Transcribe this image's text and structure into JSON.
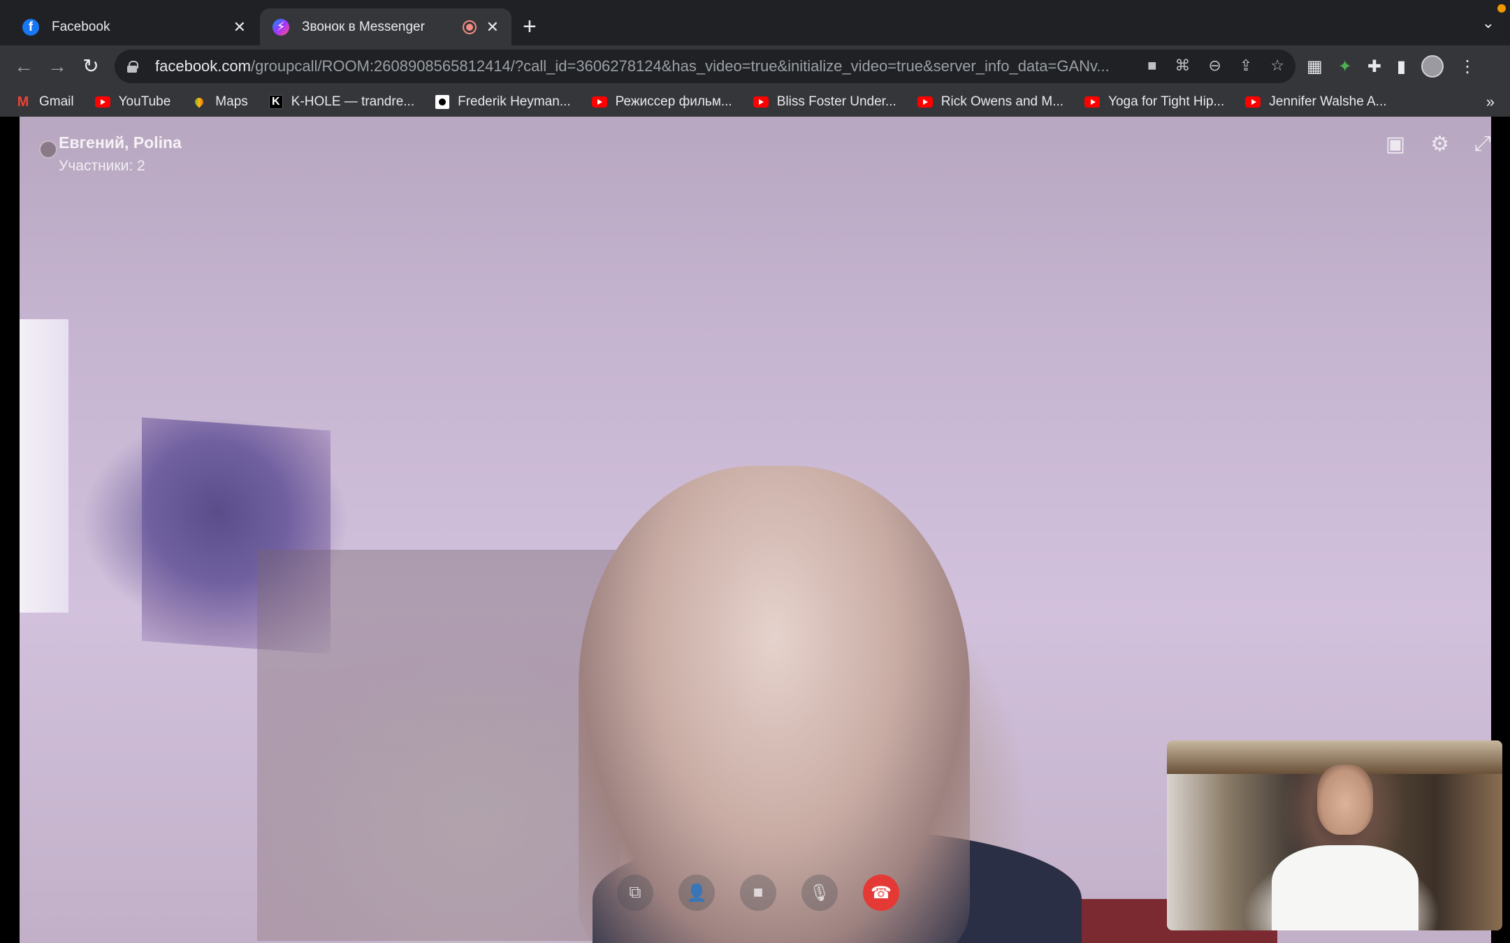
{
  "tabs": [
    {
      "title": "Facebook",
      "active": false,
      "favicon": "facebook-icon"
    },
    {
      "title": "Звонок в Messenger",
      "active": true,
      "favicon": "messenger-icon",
      "recording": true
    }
  ],
  "toolbar": {
    "url_host": "facebook.com",
    "url_path": "/groupcall/ROOM:2608908565812414/?call_id=3606278124&has_video=true&initialize_video=true&server_info_data=GANv..."
  },
  "bookmarks": [
    {
      "label": "Gmail",
      "icon": "gmail-icon"
    },
    {
      "label": "YouTube",
      "icon": "youtube-icon"
    },
    {
      "label": "Maps",
      "icon": "maps-icon"
    },
    {
      "label": "K-HOLE — trandre...",
      "icon": "khole-icon"
    },
    {
      "label": "Frederik Heyman...",
      "icon": "dot-icon"
    },
    {
      "label": "Режиссер фильм...",
      "icon": "youtube-icon"
    },
    {
      "label": "Bliss Foster Under...",
      "icon": "youtube-icon"
    },
    {
      "label": "Rick Owens and M...",
      "icon": "youtube-icon"
    },
    {
      "label": "Yoga for Tight Hip...",
      "icon": "youtube-icon"
    },
    {
      "label": "Jennifer Walshe A...",
      "icon": "youtube-icon"
    }
  ],
  "call": {
    "participants_names": "Евгений, Polina",
    "participants_count": "Участники: 2"
  },
  "colors": {
    "end_call": "#e53935",
    "tab_bar": "#202124",
    "toolbar": "#35363a"
  }
}
